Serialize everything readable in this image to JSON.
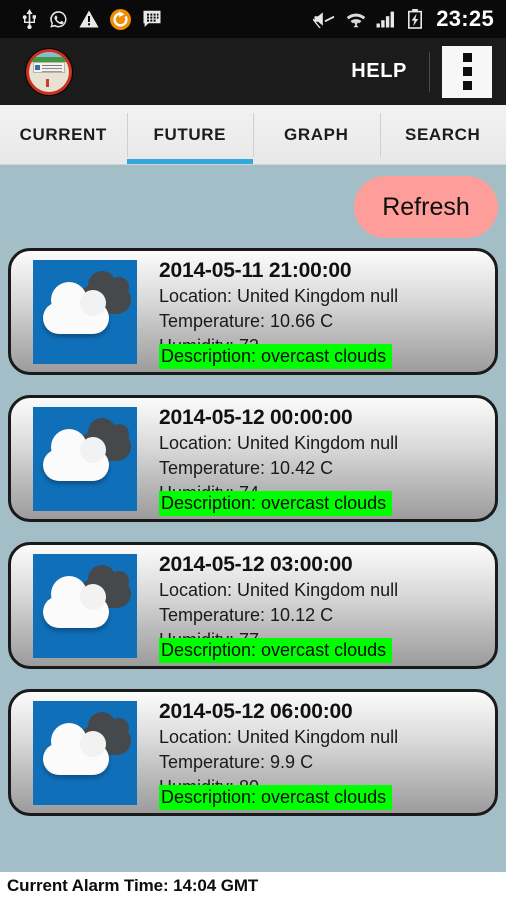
{
  "status_bar": {
    "time": "23:25",
    "left_icons": [
      "usb-icon",
      "whatsapp-icon",
      "warning-icon",
      "sync-icon",
      "bbm-message-icon"
    ],
    "right_icons": [
      "mute-icon",
      "wifi-icon",
      "signal-icon",
      "battery-charging-icon"
    ]
  },
  "action_bar": {
    "logo_name": "app-logo-icon",
    "help_label": "HELP",
    "overflow_name": "overflow-menu-icon"
  },
  "tabs": [
    {
      "label": "CURRENT",
      "active": false
    },
    {
      "label": "FUTURE",
      "active": true
    },
    {
      "label": "GRAPH",
      "active": false
    },
    {
      "label": "SEARCH",
      "active": false
    }
  ],
  "toolbar": {
    "refresh_label": "Refresh",
    "refresh_color": "#fd9e9a"
  },
  "theme": {
    "background": "#a4bec8",
    "tab_indicator": "#31a9dd",
    "highlight": "#00ff00",
    "icon_background": "#0f6fb8"
  },
  "forecast": [
    {
      "datetime": "2014-05-11 21:00:00",
      "location": "Location: United Kingdom null",
      "temperature": "Temperature: 10.66 C",
      "humidity": "Humidity: 73",
      "description": "Description: overcast clouds",
      "icon": "overcast-clouds-icon"
    },
    {
      "datetime": "2014-05-12 00:00:00",
      "location": "Location: United Kingdom null",
      "temperature": "Temperature: 10.42 C",
      "humidity": "Humidity: 74",
      "description": "Description: overcast clouds",
      "icon": "overcast-clouds-icon"
    },
    {
      "datetime": "2014-05-12 03:00:00",
      "location": "Location: United Kingdom null",
      "temperature": "Temperature: 10.12 C",
      "humidity": "Humidity: 77",
      "description": "Description: overcast clouds",
      "icon": "overcast-clouds-icon"
    },
    {
      "datetime": "2014-05-12 06:00:00",
      "location": "Location: United Kingdom null",
      "temperature": "Temperature: 9.9 C",
      "humidity": "Humidity: 80",
      "description": "Description: overcast clouds",
      "icon": "overcast-clouds-icon"
    }
  ],
  "bottom_bar": {
    "alarm_text": "Current Alarm Time: 14:04 GMT"
  }
}
